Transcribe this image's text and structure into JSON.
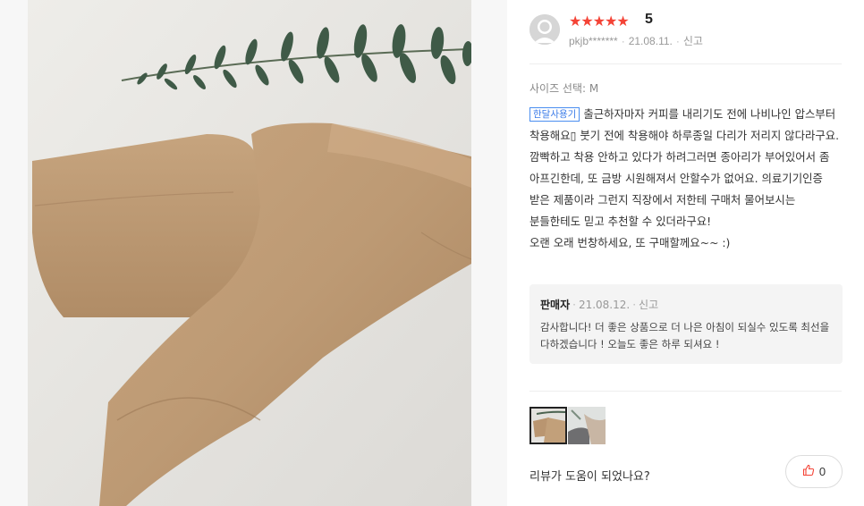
{
  "review": {
    "rating_stars": "★★★★★",
    "rating_value": "5",
    "username": "pkjb*******",
    "date": "21.08.11.",
    "report_label": "신고",
    "option_text": "사이즈 선택: M",
    "tag": "한달사용기",
    "body_line1": "출근하자마자 커피를 내리기도 전에 나비나인 압스부터 착용해요▯ 붓기 전에 착용해야 하루종일 다리가 저리지 않다라구요. 깜빡하고 착용 안하고 있다가 하려그러면 종아리가 부어있어서 좀 아프긴한데, 또 금방 시원해져서 안할수가 없어요. 의료기기인증 받은 제품이라 그런지 직장에서 저한테 구매처 물어보시는 분들한테도 믿고 추천할 수 있더라구요!",
    "body_line2": "오랜 오래 번창하세요, 또 구매할께요~~ :)"
  },
  "seller_reply": {
    "name": "판매자",
    "date": "21.08.12.",
    "report_label": "신고",
    "text": "감사합니다! 더 좋은 상품으로 더 나은 아침이 되실수 있도록 최선을 다하겠습니다 ! 오늘도 좋은 하루 되셔요 !"
  },
  "footer": {
    "helpful_question": "리뷰가 도움이 되었나요?",
    "like_count": "0"
  },
  "colors": {
    "star": "#f44336",
    "tag_border": "#4a8ef0",
    "like_icon": "#f44336"
  },
  "icons": {
    "avatar": "user-avatar-icon",
    "like": "thumbs-up-icon"
  }
}
